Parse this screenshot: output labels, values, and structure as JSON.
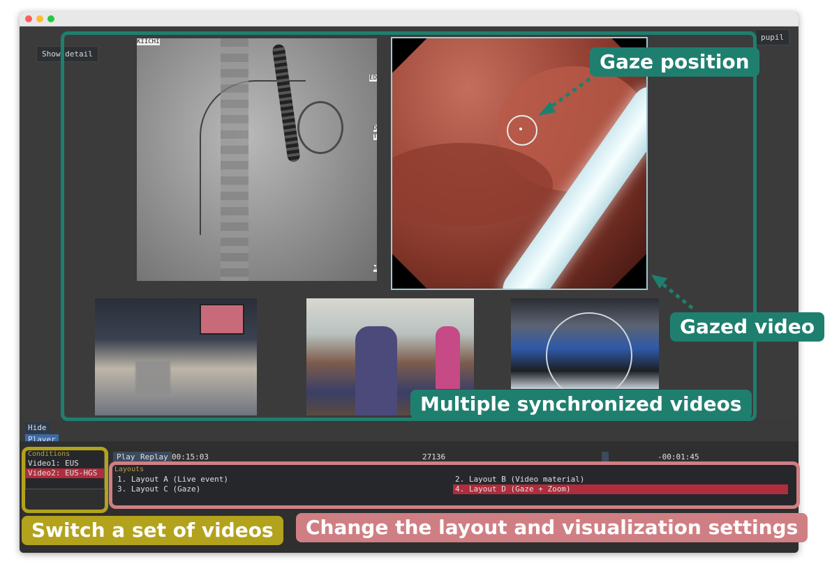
{
  "window": {
    "buttons": {
      "show_detail": "Show detail",
      "pupil": "pupil"
    }
  },
  "videos": {
    "xray_overlay_top": "KIICHI",
    "xray_overlay_right": [
      "ED",
      "D",
      "T",
      "W"
    ]
  },
  "annotations": {
    "gaze_position": "Gaze position",
    "gazed_video": "Gazed video",
    "multiple_videos": "Multiple synchronized videos",
    "switch_set": "Switch a set of videos",
    "change_layout": "Change the layout and visualization settings"
  },
  "tabs": {
    "hide": "Hide",
    "player": "Player"
  },
  "conditions": {
    "title": "Conditions",
    "items": [
      "Video1: EUS",
      "Video2: EUS-HGS"
    ],
    "selected_index": 1
  },
  "player": {
    "play": "Play",
    "replay": "Replay",
    "time": "00:15:03",
    "frame": "27136",
    "remaining": "-00:01:45"
  },
  "layouts": {
    "title": "Layouts",
    "items": [
      "1. Layout A (Live event)",
      "2. Layout B (Video material)",
      "3. Layout C (Gaze)",
      "4. Layout D (Gaze + Zoom)"
    ],
    "selected_index": 3
  },
  "colors": {
    "teal": "#1f7f6f",
    "olive": "#b3a21c",
    "rose": "#cf7f83",
    "selection": "#b02d3d"
  }
}
